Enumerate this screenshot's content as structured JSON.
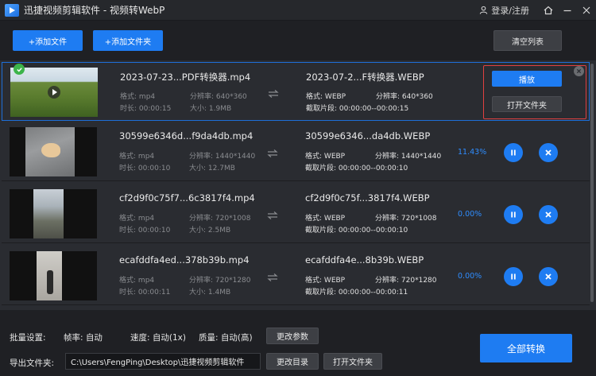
{
  "window": {
    "app_name": "迅捷视频剪辑软件",
    "separator": "-",
    "module": "视频转WebP",
    "login_label": "登录/注册"
  },
  "toolbar": {
    "add_file": "+添加文件",
    "add_folder": "+添加文件夹",
    "clear_list": "清空列表"
  },
  "labels": {
    "format": "格式:",
    "resolution": "分辨率:",
    "duration": "时长:",
    "size": "大小:",
    "clip": "截取片段:"
  },
  "rows": [
    {
      "source_name": "2023-07-23...PDF转换器.mp4",
      "format": "mp4",
      "resolution": "640*360",
      "duration": "00:00:15",
      "size": "1.9MB",
      "output_name": "2023-07-2...F转换器.WEBP",
      "out_format": "WEBP",
      "out_resolution": "640*360",
      "clip": "00:00:00--00:00:15",
      "status": "done",
      "play_label": "播放",
      "open_folder_label": "打开文件夹"
    },
    {
      "source_name": "30599e6346d...f9da4db.mp4",
      "format": "mp4",
      "resolution": "1440*1440",
      "duration": "00:00:10",
      "size": "12.7MB",
      "output_name": "30599e6346...da4db.WEBP",
      "out_format": "WEBP",
      "out_resolution": "1440*1440",
      "clip": "00:00:00--00:00:10",
      "progress": "11.43%"
    },
    {
      "source_name": "cf2d9f0c75f7...6c3817f4.mp4",
      "format": "mp4",
      "resolution": "720*1008",
      "duration": "00:00:10",
      "size": "2.5MB",
      "output_name": "cf2d9f0c75f...3817f4.WEBP",
      "out_format": "WEBP",
      "out_resolution": "720*1008",
      "clip": "00:00:00--00:00:10",
      "progress": "0.00%"
    },
    {
      "source_name": "ecafddfa4ed...378b39b.mp4",
      "format": "mp4",
      "resolution": "720*1280",
      "duration": "00:00:11",
      "size": "1.4MB",
      "output_name": "ecafddfa4e...8b39b.WEBP",
      "out_format": "WEBP",
      "out_resolution": "720*1280",
      "clip": "00:00:00--00:00:11",
      "progress": "0.00%"
    }
  ],
  "bottom": {
    "batch_settings": "批量设置:",
    "frame_rate": "帧率: 自动",
    "speed": "速度: 自动(1x)",
    "quality": "质量: 自动(高)",
    "change_params": "更改参数",
    "export_folder": "导出文件夹:",
    "export_path": "C:\\Users\\FengPing\\Desktop\\迅捷视频剪辑软件",
    "change_dir": "更改目录",
    "open_folder": "打开文件夹",
    "convert_all": "全部转换"
  },
  "colors": {
    "accent": "#1e7cf2",
    "progress_text": "#2f8dff",
    "highlight_border": "#e04040",
    "done_badge": "#3cb44a"
  },
  "icons": [
    "app-logo-icon",
    "user-icon",
    "home-icon",
    "minimize-icon",
    "close-icon",
    "swap-arrows-icon",
    "pause-icon",
    "cancel-icon",
    "checkmark-icon",
    "play-icon"
  ]
}
